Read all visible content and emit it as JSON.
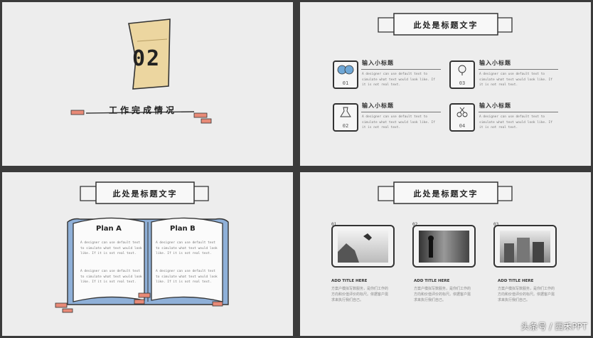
{
  "slide1": {
    "number": "02",
    "title": "工作完成情况"
  },
  "slide2": {
    "banner": "此处是标题文字",
    "features": [
      {
        "subtitle": "输入小标题",
        "num": "01",
        "desc": "A designer can use default text to simulate what text would look like. If it is not real text."
      },
      {
        "subtitle": "输入小标题",
        "num": "03",
        "desc": "A designer can use default text to simulate what text would look like. If it is not real text."
      },
      {
        "subtitle": "输入小标题",
        "num": "02",
        "desc": "A designer can use default text to simulate what text would look like. If it is not real text."
      },
      {
        "subtitle": "输入小标题",
        "num": "04",
        "desc": "A designer can use default text to simulate what text would look like. If it is not real text."
      }
    ]
  },
  "slide3": {
    "banner": "此处是标题文字",
    "plan_a": {
      "title": "Plan A",
      "text1": "A designer can use default text to simulate what text would look like. If it is not real text.",
      "text2": "A designer can use default text to simulate what text would look like. If it is not real text."
    },
    "plan_b": {
      "title": "Plan B",
      "text1": "A designer can use default text to simulate what text would look like. If it is not real text.",
      "text2": "A designer can use default text to simulate what text would look like. If it is not real text."
    }
  },
  "slide4": {
    "banner": "此处是标题文字",
    "items": [
      {
        "num": "01",
        "title": "ADD TITLE HERE",
        "desc": "方案户模拟写数服务，是你们工作的方向和价值评价的标尺。依据客户需求来执行我们自己。"
      },
      {
        "num": "02",
        "title": "ADD TITLE HERE",
        "desc": "方案户模拟写数服务，是你们工作的方向和价值评价的标尺。依据客户需求来执行我们自己。"
      },
      {
        "num": "03",
        "title": "ADD TITLE HERE",
        "desc": "方案户模拟写数服务，是你们工作的方向和价值评价的标尺。依据客户需求来执行我们自己。"
      }
    ]
  },
  "watermark": "头条号 / 西禾PPT"
}
